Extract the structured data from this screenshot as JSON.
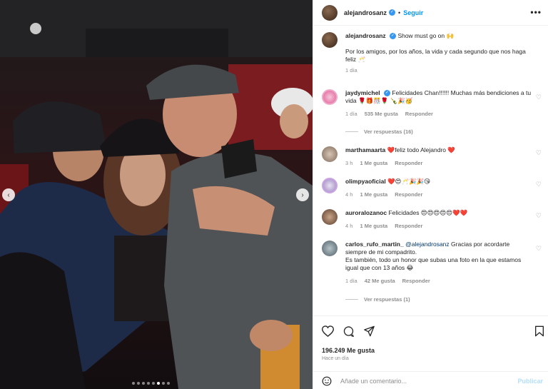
{
  "post": {
    "username": "alejandrosanz",
    "follow_label": "Seguir",
    "more_label": "•••",
    "caption_line1": "Show must go on 🙌",
    "caption_line2": "Por los amigos, por los años, la vida y cada segundo que nos haga feliz 🥂",
    "caption_time": "1 día",
    "likes": "196.249 Me gusta",
    "posted_ago": "Hace un día"
  },
  "comments": [
    {
      "username": "jaydymichel",
      "verified": true,
      "text": "Felicidades Chan!!!!!! Muchas más bendiciones a tu vida 🌹🎁🎊🌹 🍾🎉🥳",
      "time": "1 día",
      "likes": "535 Me gusta",
      "reply": "Responder",
      "view_replies": "Ver respuestas (16)"
    },
    {
      "username": "marthamaarta",
      "text": "❤️feliz todo Alejandro ❤️",
      "time": "3 h",
      "likes": "1 Me gusta",
      "reply": "Responder"
    },
    {
      "username": "olimpyaoficial",
      "text": "❤️😍🥂🎉🎉😘",
      "time": "4 h",
      "likes": "1 Me gusta",
      "reply": "Responder"
    },
    {
      "username": "auroralozanoc",
      "text": "Felicidades 😍😍😍😍😍❤️❤️",
      "time": "4 h",
      "likes": "1 Me gusta",
      "reply": "Responder"
    },
    {
      "username": "carlos_rufo_martin_",
      "mention": "@alejandrosanz",
      "text_before": "Gracias por acordarte siempre de mi compadrito.",
      "text_after": "Es también, todo un honor que subas una foto en la que estamos igual que con 13 años 😂",
      "time": "1 día",
      "likes": "42 Me gusta",
      "reply": "Responder",
      "view_replies": "Ver respuestas (1)"
    }
  ],
  "comment_box": {
    "placeholder": "Añade un comentario...",
    "publish_label": "Publicar"
  },
  "colors": {
    "accent": "#0095f6",
    "verified": "#3897f0",
    "heart": "#ed4956"
  },
  "icons": [
    "heart-icon",
    "comment-icon",
    "share-icon",
    "bookmark-icon",
    "emoji-icon",
    "more-icon",
    "verified-icon",
    "chevron-left-icon",
    "chevron-right-icon"
  ]
}
